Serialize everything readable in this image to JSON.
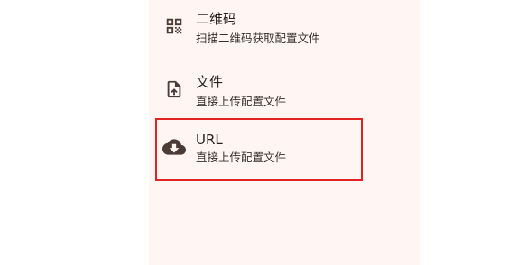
{
  "menu": {
    "items": [
      {
        "title": "二维码",
        "description": "扫描二维码获取配置文件",
        "icon": "qr-code-icon"
      },
      {
        "title": "文件",
        "description": "直接上传配置文件",
        "icon": "file-upload-icon"
      },
      {
        "title": "URL",
        "description": "直接上传配置文件",
        "icon": "cloud-download-icon"
      }
    ]
  },
  "colors": {
    "panel_background": "#fff6f4",
    "selected_outline": "#e02222",
    "icon": "#4a3b37"
  }
}
